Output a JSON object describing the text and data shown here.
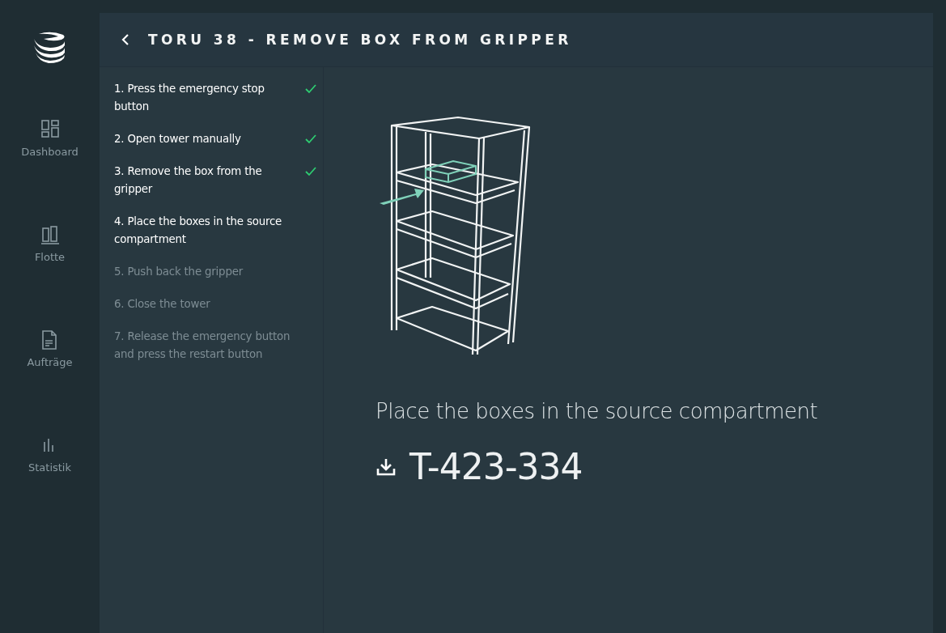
{
  "sidebar": {
    "items": [
      {
        "label": "Dashboard",
        "kind": "dashboard"
      },
      {
        "label": "Flotte",
        "kind": "fleet"
      },
      {
        "label": "Aufträge",
        "kind": "orders"
      },
      {
        "label": "Statistik",
        "kind": "stats"
      }
    ]
  },
  "header": {
    "title": "TORU 38 - REMOVE BOX FROM GRIPPER"
  },
  "steps": [
    {
      "text": "1. Press the emergency stop button",
      "checked": true,
      "disabled": false
    },
    {
      "text": "2. Open tower manually",
      "checked": true,
      "disabled": false
    },
    {
      "text": "3. Remove the box from the gripper",
      "checked": true,
      "disabled": false
    },
    {
      "text": "4. Place the boxes in the source compartment",
      "checked": false,
      "disabled": false
    },
    {
      "text": "5. Push back the gripper",
      "checked": false,
      "disabled": true
    },
    {
      "text": "6. Close the tower",
      "checked": false,
      "disabled": true
    },
    {
      "text": "7. Release the emergency button and press the restart button",
      "checked": false,
      "disabled": true
    }
  ],
  "instruction": {
    "text": "Place the boxes in the source compartment",
    "code": "T-423-334"
  }
}
